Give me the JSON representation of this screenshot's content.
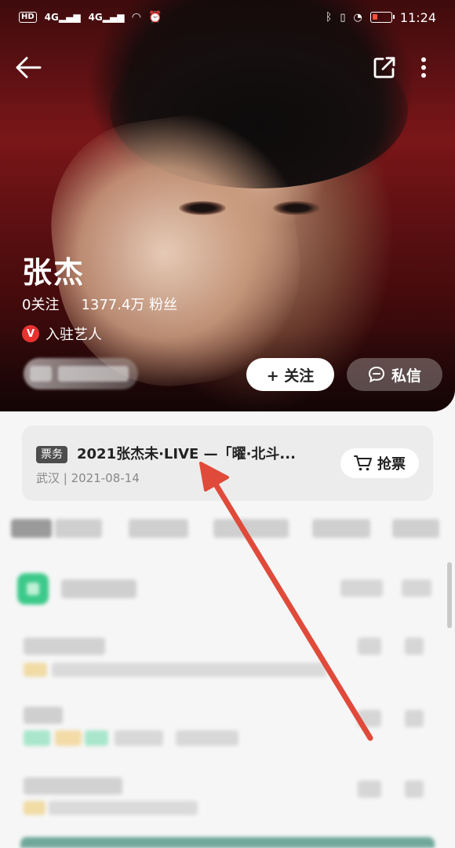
{
  "status_bar": {
    "network_labels": [
      "HD",
      "4G",
      "4G"
    ],
    "time": "11:24"
  },
  "artist": {
    "name": "张杰",
    "following": "0关注",
    "followers": "1377.4万 粉丝",
    "verified_badge": "V",
    "verified_label": "入驻艺人"
  },
  "actions": {
    "follow_label": "+ 关注",
    "message_label": "私信"
  },
  "ticket": {
    "tag": "票务",
    "title": "2021张杰未·LIVE —「曜·北斗...",
    "meta": "武汉 | 2021-08-14",
    "buy_label": "抢票"
  },
  "icons": {
    "back": "back-arrow-icon",
    "share": "share-icon",
    "more": "more-vertical-icon",
    "cart": "cart-icon",
    "chat": "chat-icon"
  },
  "colors": {
    "verified_red": "#e8322f",
    "arrow_red": "#e04a3a",
    "green_accent": "#3cc98a"
  }
}
